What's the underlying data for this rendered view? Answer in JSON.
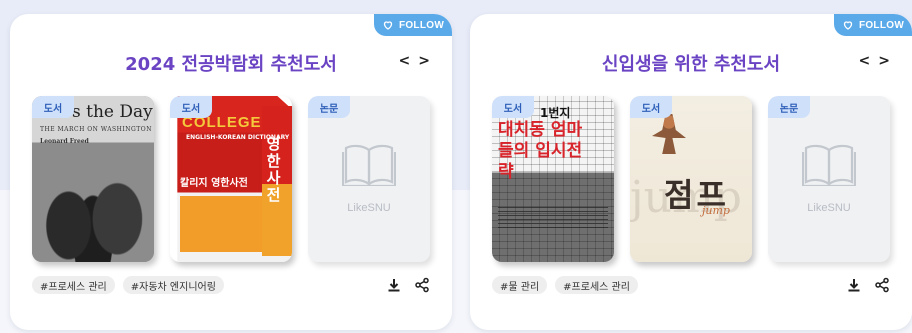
{
  "cards": [
    {
      "follow_label": "FOLLOW",
      "title": "2024 전공박람회 추천도서",
      "nav": {
        "prev": "<",
        "next": ">"
      },
      "books": [
        {
          "badge": "도서",
          "cover": {
            "line1": "s the Day",
            "line2": "THE MARCH ON WASHINGTON",
            "line3": "Leonard Freed"
          }
        },
        {
          "badge": "도서",
          "cover": {
            "line1": "COLLEGE",
            "line2": "ENGLISH-KOREAN DICTIONARY",
            "line3": "칼리지 영한사전",
            "vertical": "영한사전"
          }
        },
        {
          "badge": "논문",
          "placeholder": "LikeSNU"
        }
      ],
      "tags": [
        "#프로세스 관리",
        "#자동차 엔지니어링"
      ]
    },
    {
      "follow_label": "FOLLOW",
      "title": "신입생을 위한 추천도서",
      "nav": {
        "prev": "<",
        "next": ">"
      },
      "books": [
        {
          "badge": "도서",
          "cover": {
            "line1": "1번지",
            "line2": "대치동 엄마들의 입시전략"
          }
        },
        {
          "badge": "도서",
          "cover": {
            "line1": "점프",
            "line2": "jump"
          }
        },
        {
          "badge": "논문",
          "placeholder": "LikeSNU"
        }
      ],
      "tags": [
        "#물 관리",
        "#프로세스 관리"
      ]
    }
  ],
  "colors": {
    "accent": "#6b44c4",
    "follow_bg": "#5aa9e9",
    "badge_bg": "#cfe0fb",
    "badge_text": "#2e5fb8"
  },
  "icons": {
    "follow": "heart-icon",
    "download": "download-icon",
    "share": "share-icon",
    "placeholder": "open-book-icon"
  }
}
